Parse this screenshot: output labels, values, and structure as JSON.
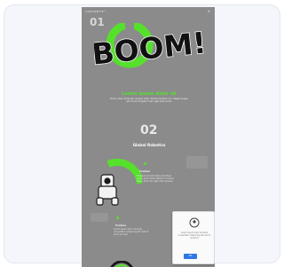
{
  "page": {
    "logo_text": "CARTLEBYTE™",
    "close_glyph": "×",
    "section1_number": "01",
    "hero_word": "BOOM!",
    "headline": "Lorem ipsum dolor sit",
    "paragraph": "Donec vitae, brute est, aenean ullam. Nullam facilisis orci. Integer augue, est. Donec fringilla id est, eget dolor porta.",
    "section2_number": "02",
    "section2_title": "Global Robotics",
    "feature_title": "Feature",
    "feature_text": "Praesent sit amet tellus sed libero varius porta. Nulla efficitur tincidunt tellus, dolor non eget dolor gravida.",
    "bottom_title": "Feature",
    "bottom_text": "Lorem ipsum dolor sit amet, consectetur adipiscing elit. Sed at lacus vel erat.",
    "popup_text": "Lorem ipsum dolor sit amet consectetur adipiscing elit sed do eiusmod",
    "popup_button": "OK"
  },
  "colors": {
    "accent_green": "#55e12b",
    "frame_gray": "#8b8b8b",
    "button_blue": "#2f76e6"
  },
  "icons": [
    "close-icon",
    "power-icon",
    "robot-icon",
    "popup-illustration-icon"
  ]
}
